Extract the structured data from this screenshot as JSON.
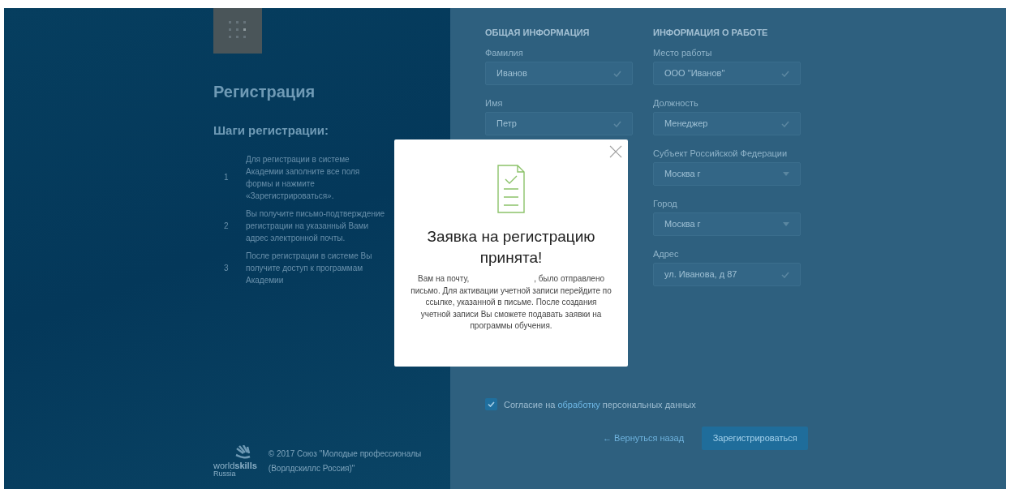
{
  "sidebar": {
    "title": "Регистрация",
    "steps_title": "Шаги регистрации:",
    "steps": [
      {
        "number": "1",
        "text": "Для регистрации в системе Академии заполните все поля формы и нажмите «Зарегистрироваться»."
      },
      {
        "number": "2",
        "text": "Вы получите письмо-подтверждение регистрации на указанный Вами адрес электронной почты."
      },
      {
        "number": "3",
        "text": "После регистрации в системе Вы получите доступ к программам Академии"
      }
    ],
    "footer": {
      "logo_word_light": "world",
      "logo_word_bold": "skills",
      "logo_country": "Russia",
      "copyright": "© 2017 Союз \"Молодые профессионалы (Ворлдскиллс Россия)\""
    }
  },
  "form": {
    "columns": [
      {
        "heading": "ОБЩАЯ ИНФОРМАЦИЯ",
        "fields": [
          {
            "label": "Фамилия",
            "value": "Иванов",
            "kind": "text"
          },
          {
            "label": "Имя",
            "value": "Петр",
            "kind": "text"
          }
        ]
      },
      {
        "heading": "ИНФОРМАЦИЯ О РАБОТЕ",
        "fields": [
          {
            "label": "Место работы",
            "value": "ООО \"Иванов\"",
            "kind": "text"
          },
          {
            "label": "Должность",
            "value": "Менеджер",
            "kind": "text"
          },
          {
            "label": "Субъект Российской Федерации",
            "value": "Москва г",
            "kind": "select"
          },
          {
            "label": "Город",
            "value": "Москва г",
            "kind": "select"
          },
          {
            "label": "Адрес",
            "value": "ул. Иванова, д 87",
            "kind": "text"
          }
        ]
      }
    ],
    "consent": {
      "checked": true,
      "text_before": "Согласие на",
      "link": "обработку",
      "text_after": "персональных данных"
    },
    "back_link": "← Вернуться назад",
    "submit": "Зарегистрироваться"
  },
  "modal": {
    "title": "Заявка на регистрацию принята!",
    "message_start": "Вам на почту,",
    "message_end": ", было отправлено письмо. Для активации учетной записи перейдите по ссылке, указанной в письме. После создания учетной записи Вы сможете подавать заявки на программы обучения."
  }
}
